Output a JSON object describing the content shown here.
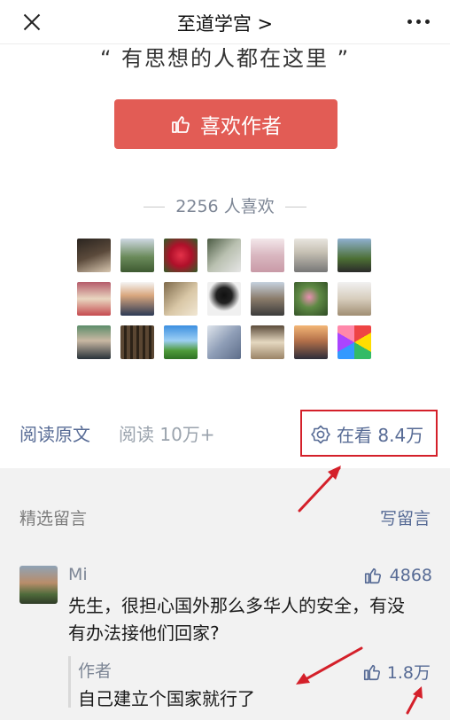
{
  "nav": {
    "title": "至道学宫 >"
  },
  "slogan": "“ 有思想的人都在这里 ”",
  "like_author": {
    "label": "喜欢作者"
  },
  "likes": {
    "text": "2256 人喜欢"
  },
  "actions": {
    "read_original": "阅读原文",
    "read_count": "阅读 10万+",
    "zaikan": "在看 8.4万"
  },
  "comments": {
    "title": "精选留言",
    "write": "写留言",
    "items": [
      {
        "name": "Mi",
        "likes": "4868",
        "text": "先生，很担心国外那么多华人的安全，有没有办法接他们回家?",
        "reply": {
          "author": "作者",
          "text": "自己建立个国家就行了",
          "likes": "1.8万"
        }
      }
    ]
  },
  "colors": {
    "accent": "#e25c55",
    "link": "#576b95",
    "annotation": "#d4202a"
  }
}
